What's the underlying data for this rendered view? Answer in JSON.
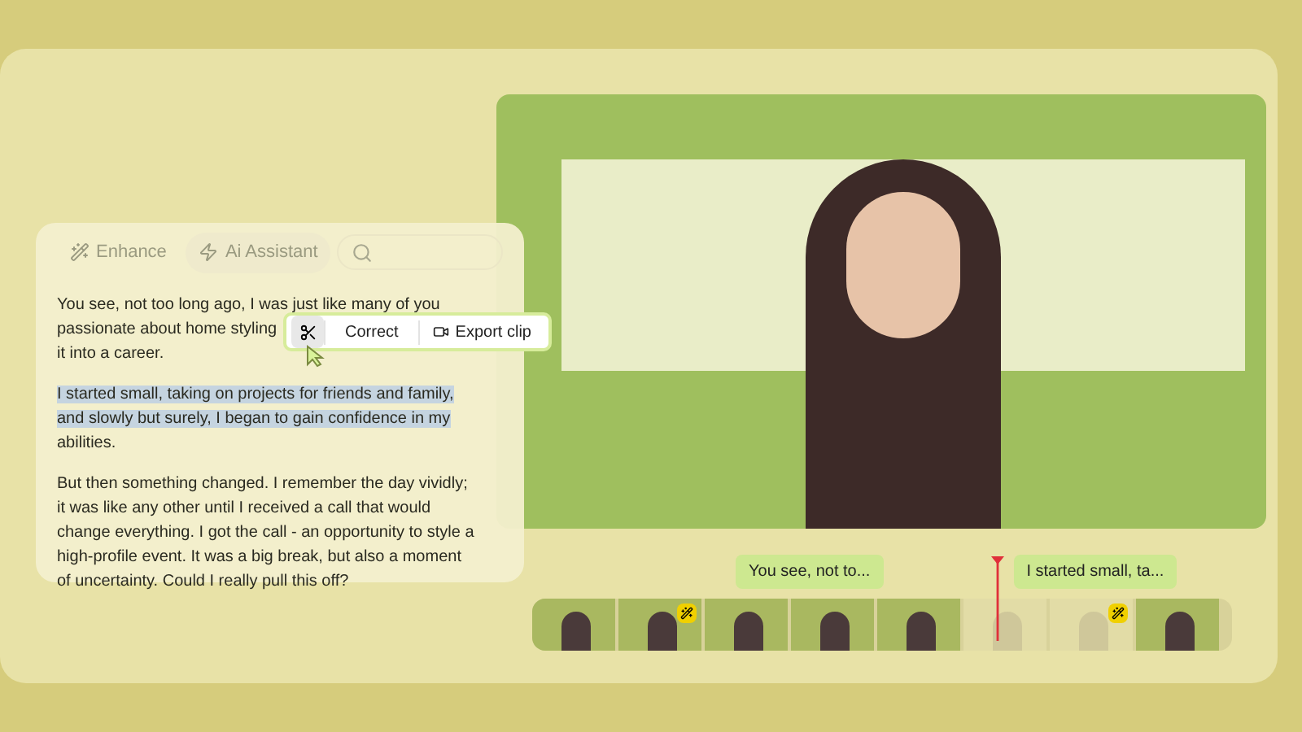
{
  "toolbar": [
    {
      "kind": "enhance",
      "label": "Enhance"
    },
    {
      "kind": "assistant",
      "label": "Ai Assistant"
    },
    {
      "kind": "search"
    }
  ],
  "paragraphs": [
    {
      "selected": false,
      "lines": [
        "You see, not too long ago, I was just like many of you",
        "passionate about home styling",
        "it into a career."
      ]
    },
    {
      "selected": true,
      "lines": [
        "I started small, taking on projects for friends and family,",
        "and slowly but surely, I began to gain confidence in my",
        "abilities."
      ]
    },
    {
      "selected": false,
      "lines": [
        "But then something changed. I remember the day vividly;",
        "it was like any other until I received a call that would",
        "change everything. I got the call - an opportunity to style a",
        "high-profile event. It was a big break, but also a moment",
        "of uncertainty. Could I really pull this off?"
      ]
    }
  ],
  "popup": {
    "actions": [
      {
        "kind": "cut"
      },
      {
        "kind": "text",
        "label": "Correct"
      },
      {
        "kind": "export",
        "label": "Export clip"
      }
    ]
  },
  "timeline": {
    "captions": [
      "You see, not to...",
      "I started small, ta..."
    ],
    "frames": [
      {
        "dimmed": false,
        "badge": false
      },
      {
        "dimmed": false,
        "badge": true
      },
      {
        "dimmed": false,
        "badge": false
      },
      {
        "dimmed": false,
        "badge": false
      },
      {
        "dimmed": false,
        "badge": false
      },
      {
        "dimmed": true,
        "badge": false
      },
      {
        "dimmed": true,
        "badge": true
      },
      {
        "dimmed": false,
        "badge": false
      }
    ]
  }
}
